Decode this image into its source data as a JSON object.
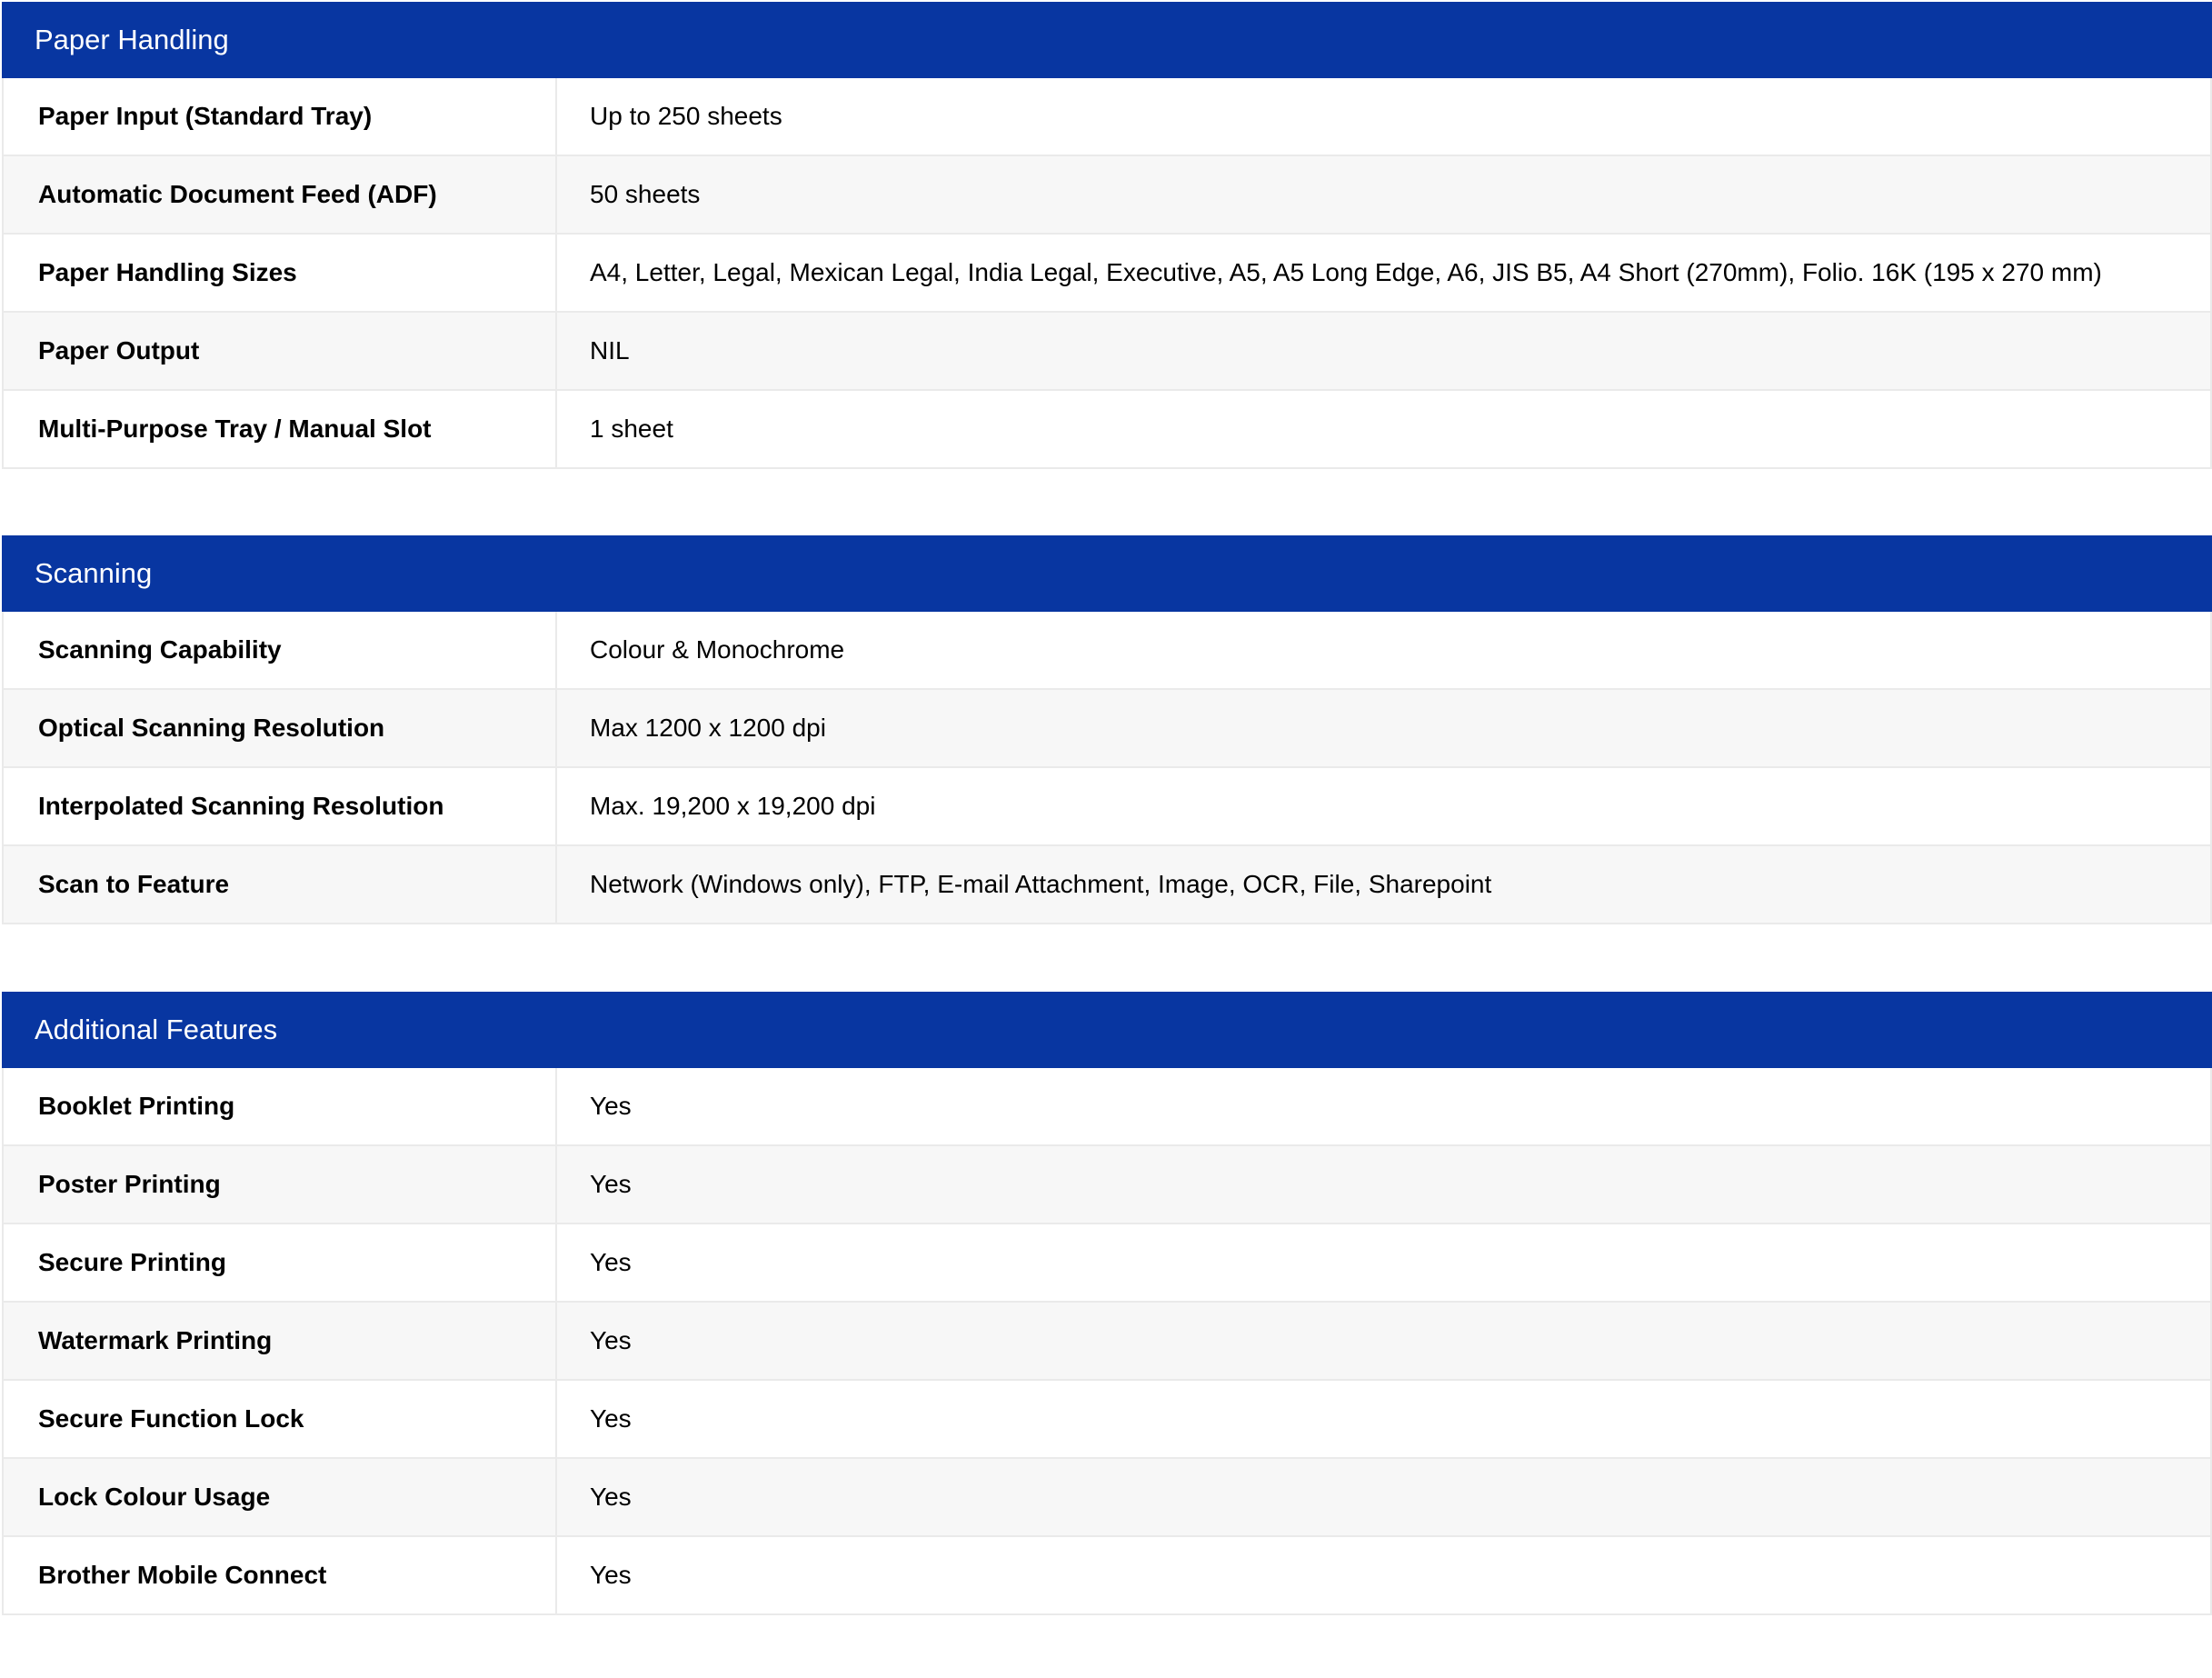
{
  "sections": [
    {
      "title": "Paper Handling",
      "rows": [
        {
          "label": "Paper Input (Standard Tray)",
          "value": "Up to 250 sheets"
        },
        {
          "label": "Automatic Document Feed (ADF)",
          "value": "50 sheets"
        },
        {
          "label": "Paper Handling Sizes",
          "value": "A4, Letter, Legal, Mexican Legal, India Legal, Executive, A5, A5 Long Edge, A6, JIS B5, A4 Short (270mm), Folio. 16K (195 x 270 mm)"
        },
        {
          "label": "Paper Output",
          "value": "NIL"
        },
        {
          "label": "Multi-Purpose Tray / Manual Slot",
          "value": "1 sheet"
        }
      ]
    },
    {
      "title": "Scanning",
      "rows": [
        {
          "label": "Scanning Capability",
          "value": "Colour & Monochrome"
        },
        {
          "label": "Optical Scanning Resolution",
          "value": "Max 1200 x 1200 dpi"
        },
        {
          "label": "Interpolated Scanning Resolution",
          "value": "Max. 19,200 x 19,200 dpi"
        },
        {
          "label": "Scan to Feature",
          "value": "Network (Windows only), FTP, E-mail Attachment, Image, OCR, File, Sharepoint"
        }
      ]
    },
    {
      "title": "Additional Features",
      "rows": [
        {
          "label": "Booklet Printing",
          "value": "Yes"
        },
        {
          "label": "Poster Printing",
          "value": "Yes"
        },
        {
          "label": "Secure Printing",
          "value": "Yes"
        },
        {
          "label": "Watermark Printing",
          "value": "Yes"
        },
        {
          "label": "Secure Function Lock",
          "value": "Yes"
        },
        {
          "label": "Lock Colour Usage",
          "value": "Yes"
        },
        {
          "label": "Brother Mobile Connect",
          "value": "Yes"
        }
      ]
    }
  ],
  "colors": {
    "header_bg": "#0836a1",
    "header_text": "#ffffff",
    "row_alt_bg": "#f7f7f7",
    "border": "#eaeaea"
  }
}
